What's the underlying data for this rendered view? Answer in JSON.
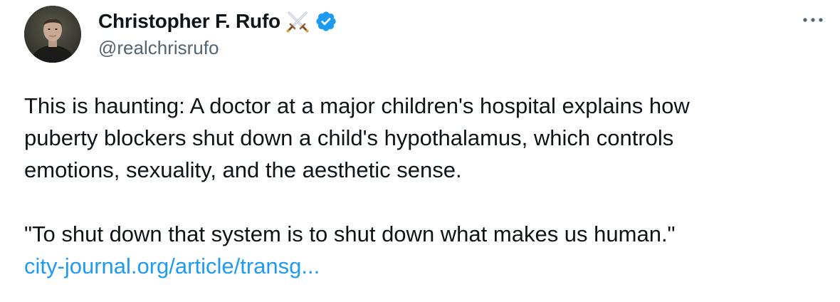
{
  "author": {
    "name": "Christopher F. Rufo",
    "handle": "@realchrisrufo",
    "avatar_icon": "avatar-photo",
    "badge_icons": [
      "crossed-swords-icon",
      "verified-badge-icon"
    ],
    "verified_color": "#1d9bf0"
  },
  "menu": {
    "icon": "more-horizontal-icon"
  },
  "tweet": {
    "lines_p1": [
      "This is haunting: A doctor at a major children's hospital explains how",
      "puberty blockers shut down a child's hypothalamus, which controls",
      "emotions, sexuality, and the aesthetic sense."
    ],
    "quote": "\"To shut down that system is to shut down what makes us human.\"",
    "link_text": "city-journal.org/article/transg..."
  },
  "colors": {
    "text": "#0f1419",
    "secondary": "#536471",
    "link": "#1d9bf0"
  }
}
